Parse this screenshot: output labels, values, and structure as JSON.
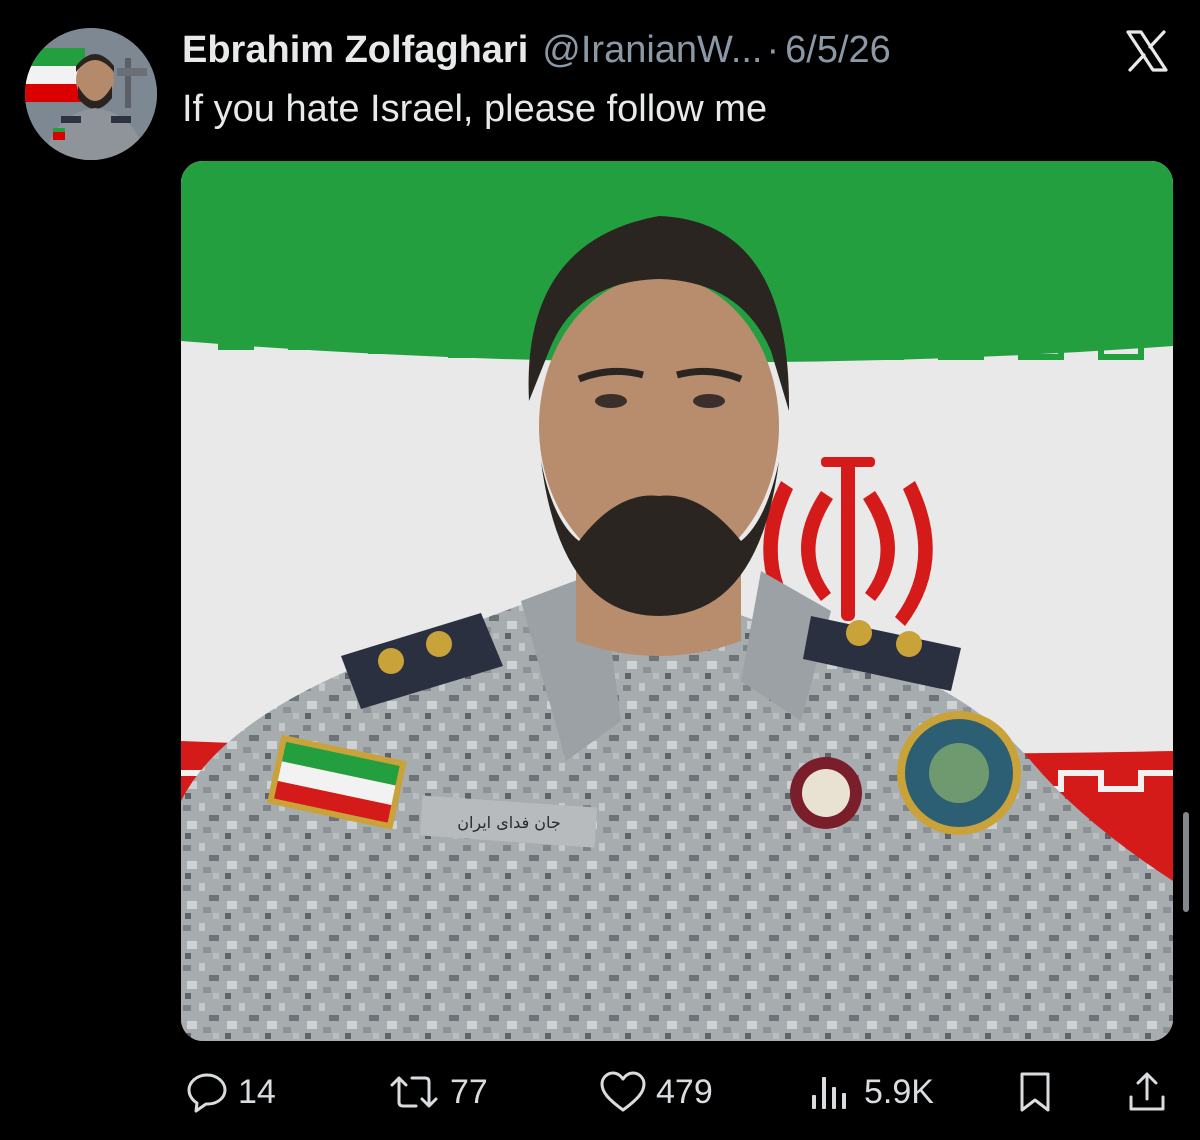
{
  "tweet": {
    "display_name": "Ebrahim Zolfaghari",
    "handle": "@IranianW...",
    "separator": "·",
    "date": "6/5/26",
    "text": "If you hate Israel, please follow me"
  },
  "media": {
    "badge_text": "جان فدای ایران"
  },
  "actions": {
    "replies": "14",
    "reposts": "77",
    "likes": "479",
    "views": "5.9K"
  },
  "icons": {
    "close": "x-logo-icon",
    "reply": "reply-icon",
    "repost": "repost-icon",
    "like": "heart-icon",
    "views": "views-bars-icon",
    "bookmark": "bookmark-icon",
    "share": "share-icon"
  },
  "colors": {
    "background": "#000000",
    "text": "#e7e9ea",
    "muted": "#8b98a5",
    "flag_green": "#239f40",
    "flag_white": "#f2f2f2",
    "flag_red": "#da0000"
  }
}
